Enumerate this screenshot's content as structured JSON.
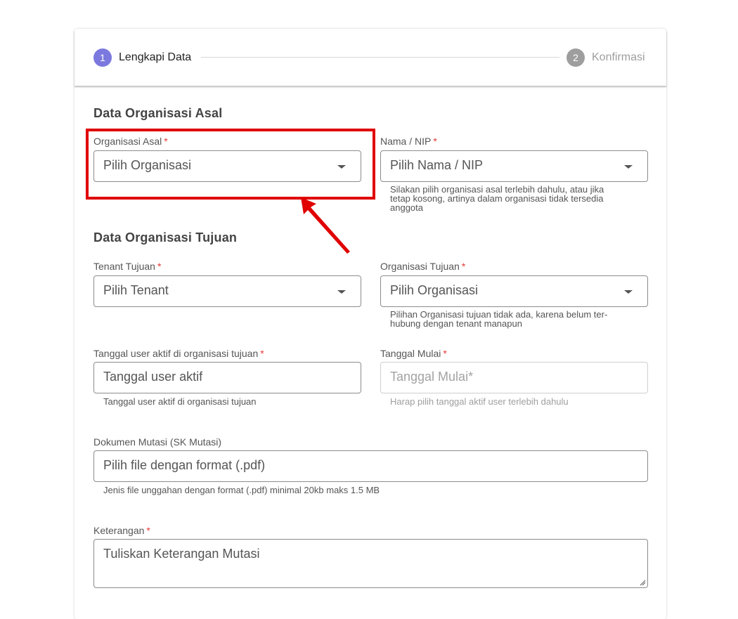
{
  "stepper": {
    "steps": [
      {
        "number": "1",
        "label": "Lengkapi Data",
        "color": "#7b79de",
        "active": true
      },
      {
        "number": "2",
        "label": "Konfirmasi",
        "color": "#9e9e9e",
        "active": false
      }
    ]
  },
  "origin": {
    "title": "Data Organisasi Asal",
    "org": {
      "label": "Organisasi Asal",
      "required": "*",
      "value": "Pilih Organisasi"
    },
    "name": {
      "label": "Nama / NIP",
      "required": "*",
      "value": "Pilih Nama / NIP",
      "hint_lines": [
        "Silakan pilih organisasi asal terlebih dahulu, atau jika",
        "tetap kosong, artinya dalam organisasi tidak tersedia",
        "anggota"
      ]
    }
  },
  "target": {
    "title": "Data Organisasi Tujuan",
    "tenant": {
      "label": "Tenant Tujuan",
      "required": "*",
      "value": "Pilih Tenant"
    },
    "org": {
      "label": "Organisasi Tujuan",
      "required": "*",
      "value": "Pilih Organisasi",
      "hint_lines": [
        "Pilihan Organisasi tujuan tidak ada, karena belum ter-",
        "hubung dengan tenant manapun"
      ]
    },
    "active_date": {
      "label": "Tanggal user aktif di organisasi tujuan",
      "required": "*",
      "placeholder": "Tanggal user aktif",
      "hint": "Tanggal user aktif di organisasi tujuan"
    },
    "start_date": {
      "label": "Tanggal Mulai",
      "required": "*",
      "placeholder": "Tanggal Mulai*",
      "hint": "Harap pilih tanggal aktif user terlebih dahulu"
    },
    "document": {
      "label": "Dokumen Mutasi (SK Mutasi)",
      "placeholder": "Pilih file dengan format (.pdf)",
      "hint": "Jenis file unggahan dengan format (.pdf) minimal 20kb maks 1.5 MB"
    },
    "notes": {
      "label": "Keterangan",
      "required": "*",
      "placeholder": "Tuliskan Keterangan Mutasi"
    }
  },
  "annotation": {
    "highlight_color": "#e00000"
  }
}
